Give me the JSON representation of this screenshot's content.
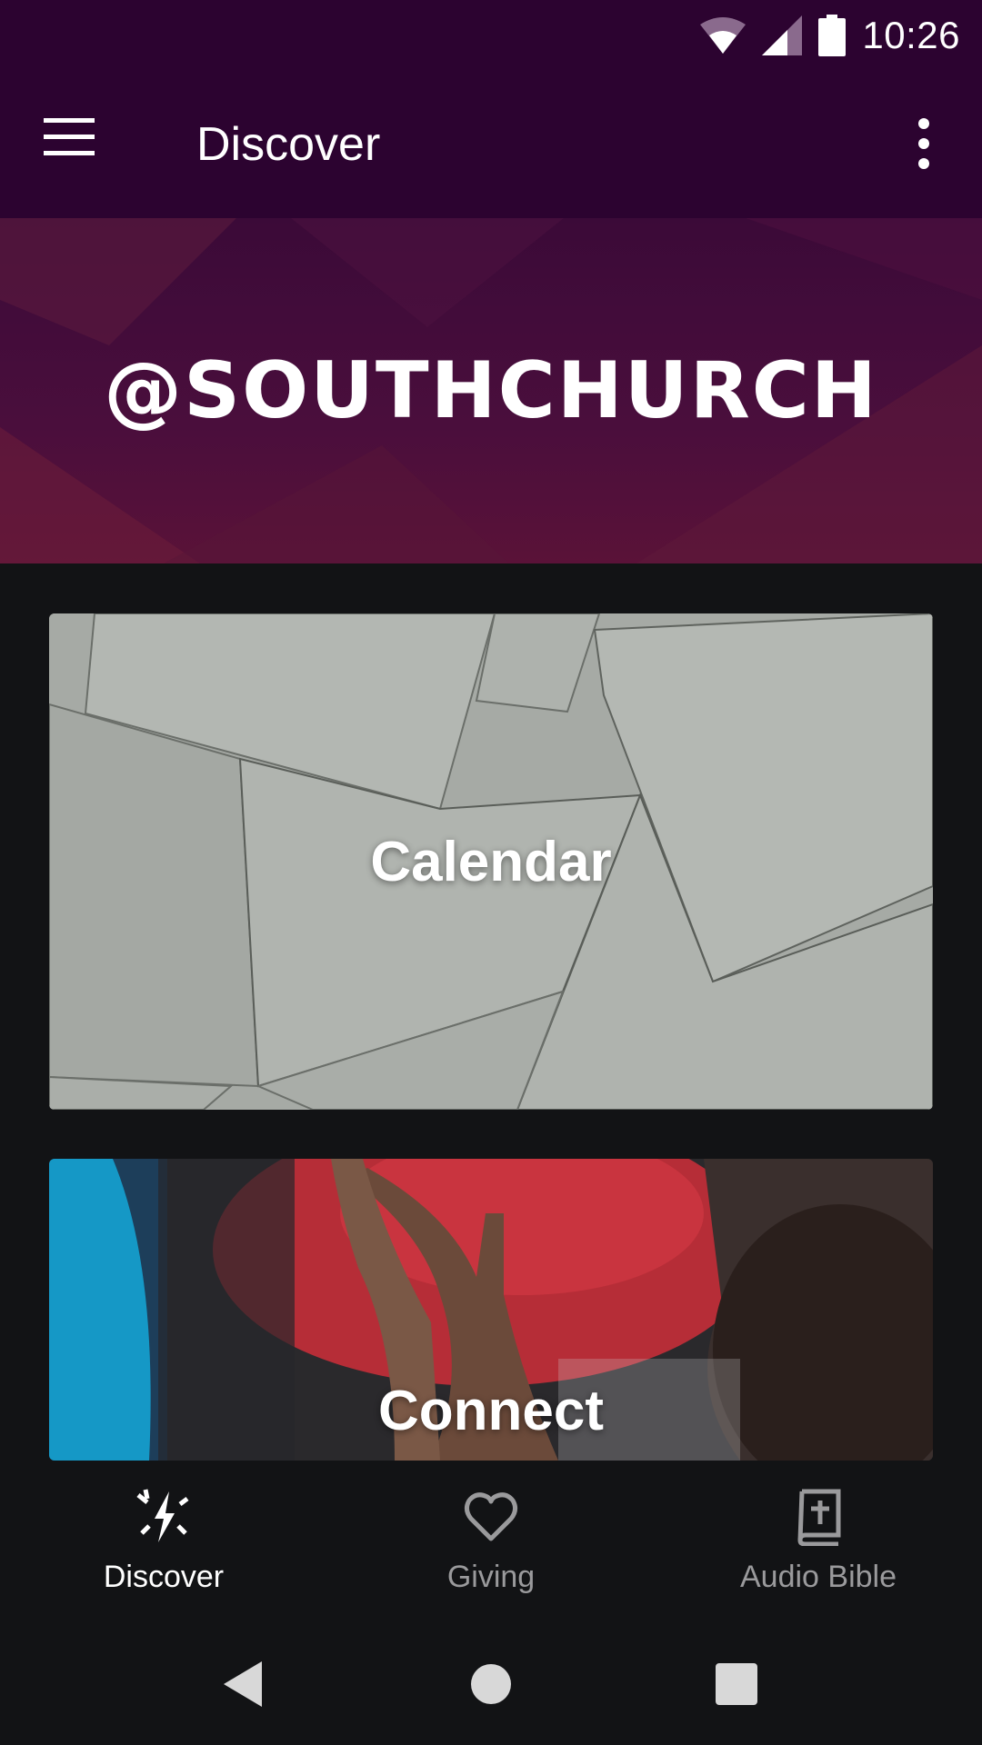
{
  "status_bar": {
    "time": "10:26",
    "icons": [
      "wifi-icon",
      "cell-signal-icon",
      "battery-icon"
    ]
  },
  "app_bar": {
    "title": "Discover",
    "menu_icon": "hamburger-menu-icon",
    "overflow_icon": "more-vert-icon",
    "background": "#2c0330"
  },
  "banner": {
    "text": "@SOUTHCHURCH"
  },
  "cards": [
    {
      "label": "Calendar"
    },
    {
      "label": "Connect"
    }
  ],
  "bottom_nav": {
    "items": [
      {
        "label": "Discover",
        "icon": "discover-sparkle-icon",
        "active": true
      },
      {
        "label": "Giving",
        "icon": "heart-icon",
        "active": false
      },
      {
        "label": "Audio Bible",
        "icon": "bible-book-icon",
        "active": false
      }
    ]
  },
  "system_nav": {
    "buttons": [
      "back-icon",
      "home-icon",
      "recents-icon"
    ]
  },
  "colors": {
    "app_bar": "#2c0330",
    "page_background": "#121315",
    "active_nav": "#ffffff",
    "inactive_nav": "#9a9a9c"
  }
}
